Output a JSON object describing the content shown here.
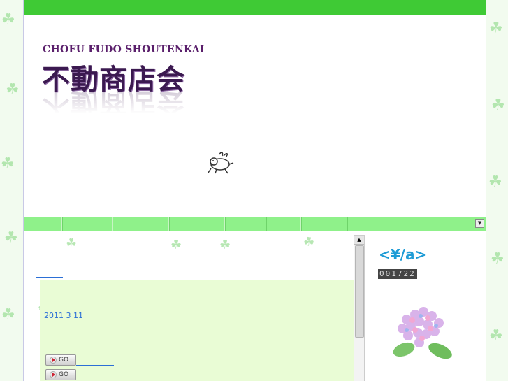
{
  "topbar": {
    "text": ""
  },
  "header": {
    "logo_en": "CHOFU FUDO SHOUTENKAI",
    "logo_jp": "不動商店会"
  },
  "nav": {
    "items": [
      "",
      "",
      "",
      "",
      "",
      "",
      ""
    ]
  },
  "post": {
    "title": "",
    "date": "2011 3 11",
    "go_label": "GO"
  },
  "sidebar": {
    "title": "<¥/a>",
    "counter": "001722"
  },
  "colors": {
    "topbar": "#3fca35",
    "nav": "#8ff18a",
    "title": "#e020c8",
    "link": "#2b6fd6",
    "panel": "#e9fcd5",
    "logo": "#3b1950"
  }
}
